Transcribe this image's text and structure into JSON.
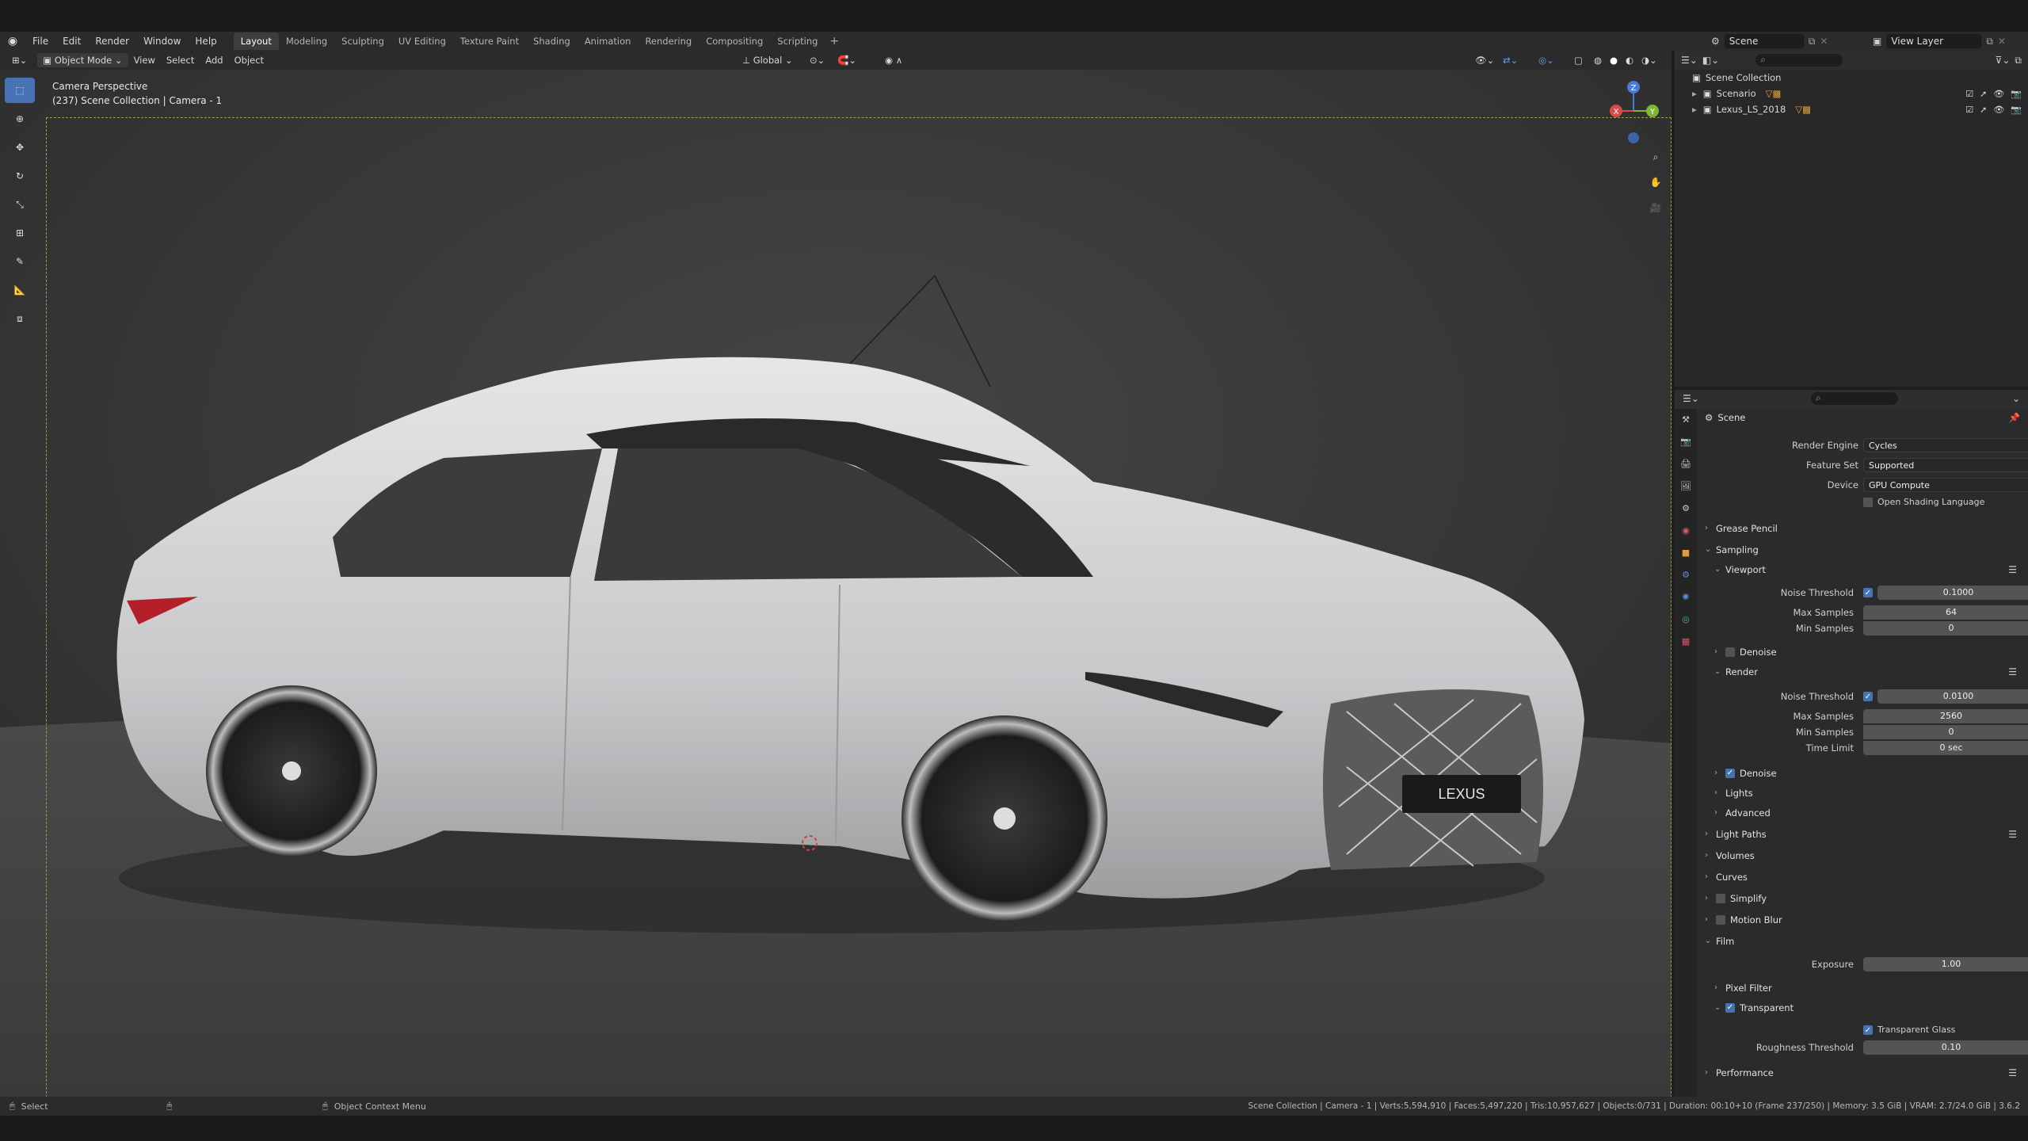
{
  "menu": {
    "items": [
      "File",
      "Edit",
      "Render",
      "Window",
      "Help"
    ],
    "workspaces": [
      "Layout",
      "Modeling",
      "Sculpting",
      "UV Editing",
      "Texture Paint",
      "Shading",
      "Animation",
      "Rendering",
      "Compositing",
      "Scripting"
    ],
    "active_workspace": "Layout",
    "add_tab": "+",
    "scene": "Scene",
    "view_layer": "View Layer"
  },
  "header": {
    "mode": "Object Mode",
    "view": "View",
    "select": "Select",
    "add": "Add",
    "object": "Object",
    "orientation": "Global"
  },
  "viewport": {
    "title": "Camera Perspective",
    "subtitle": "(237) Scene Collection | Camera - 1",
    "gizmo": {
      "x": "X",
      "y": "Y",
      "z": "Z"
    },
    "car_badge": "LEXUS"
  },
  "outliner": {
    "root": "Scene Collection",
    "items": [
      {
        "name": "Scenario"
      },
      {
        "name": "Lexus_LS_2018"
      }
    ]
  },
  "properties": {
    "title": "Scene",
    "render_engine_label": "Render Engine",
    "render_engine": "Cycles",
    "feature_set_label": "Feature Set",
    "feature_set": "Supported",
    "device_label": "Device",
    "device": "GPU Compute",
    "osl": "Open Shading Language",
    "grease_pencil": "Grease Pencil",
    "sampling": "Sampling",
    "viewport": "Viewport",
    "noise_threshold_label": "Noise Threshold",
    "vp_noise_threshold": "0.1000",
    "max_samples_label": "Max Samples",
    "vp_max_samples": "64",
    "min_samples_label": "Min Samples",
    "vp_min_samples": "0",
    "denoise": "Denoise",
    "render": "Render",
    "r_noise_threshold": "0.0100",
    "r_max_samples": "2560",
    "r_min_samples": "0",
    "time_limit_label": "Time Limit",
    "r_time_limit": "0 sec",
    "lights": "Lights",
    "advanced": "Advanced",
    "light_paths": "Light Paths",
    "volumes": "Volumes",
    "curves": "Curves",
    "simplify": "Simplify",
    "motion_blur": "Motion Blur",
    "film": "Film",
    "exposure_label": "Exposure",
    "exposure": "1.00",
    "pixel_filter": "Pixel Filter",
    "transparent": "Transparent",
    "transparent_glass": "Transparent Glass",
    "roughness_threshold_label": "Roughness Threshold",
    "roughness_threshold": "0.10",
    "performance": "Performance"
  },
  "status": {
    "select": "Select",
    "context_menu": "Object Context Menu",
    "stats": "Scene Collection | Camera - 1 | Verts:5,594,910 | Faces:5,497,220 | Tris:10,957,627 | Objects:0/731 | Duration: 00:10+10 (Frame 237/250) | Memory: 3.5 GiB | VRAM: 2.7/24.0 GiB | 3.6.2"
  },
  "colors": {
    "accent": "#4772b3",
    "car_body": "#d2d2d4",
    "camera_frame": "#a39a52"
  }
}
